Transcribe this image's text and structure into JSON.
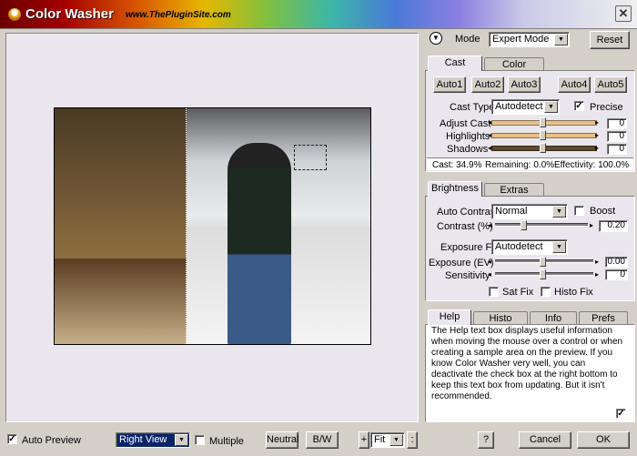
{
  "app": {
    "title": "Color Washer",
    "url": "www.ThePluginSite.com",
    "close_glyph": "✕"
  },
  "mode": {
    "label": "Mode",
    "value": "Expert Mode",
    "reset_label": "Reset"
  },
  "cast_panel": {
    "tabs": [
      {
        "label": "Cast"
      },
      {
        "label": "Color"
      }
    ],
    "auto_buttons": [
      {
        "label": "Auto1"
      },
      {
        "label": "Auto2"
      },
      {
        "label": "Auto3"
      },
      {
        "label": "Auto4"
      },
      {
        "label": "Auto5"
      }
    ],
    "cast_type_label": "Cast Type",
    "cast_type_value": "Autodetect",
    "precise_label": "Precise",
    "precise_checked": true,
    "sliders": [
      {
        "label": "Adjust Cast",
        "value": "0",
        "color": "#e6c28e"
      },
      {
        "label": "Highlights",
        "value": "0",
        "color": "#e8c080"
      },
      {
        "label": "Shadows",
        "value": "0",
        "color": "#5e4a2c"
      }
    ],
    "status": {
      "cast": "Cast: 34.9%",
      "remaining": "Remaining: 0.0%",
      "effectivity": "Effectivity: 100.0%"
    }
  },
  "brightness_panel": {
    "tabs": [
      {
        "label": "Brightness"
      },
      {
        "label": "Extras"
      }
    ],
    "auto_contrast_label": "Auto Contrast",
    "auto_contrast_value": "Normal",
    "boost_label": "Boost",
    "contrast_label": "Contrast (%)",
    "contrast_value": "0.20",
    "exposure_fix_label": "Exposure Fix",
    "exposure_fix_value": "Autodetect",
    "exposure_label": "Exposure (EV)",
    "exposure_value": "0.00",
    "sensitivity_label": "Sensitivity",
    "sensitivity_value": "0",
    "sat_fix_label": "Sat Fix",
    "histo_fix_label": "Histo Fix"
  },
  "help_panel": {
    "tabs": [
      {
        "label": "Help"
      },
      {
        "label": "Histo"
      },
      {
        "label": "Info"
      },
      {
        "label": "Prefs"
      }
    ],
    "text": "The Help text box displays useful information when moving the mouse over a control or when creating a sample area on the preview. If you know Color Washer very well, you can deactivate the check box at the right bottom to keep this text box from updating. But it isn't recommended."
  },
  "bottom_bar": {
    "auto_preview_label": "Auto Preview",
    "view_value": "Right View",
    "multiple_label": "Multiple",
    "neutral_label": "Neutral",
    "bw_label": "B/W",
    "zoom_plus": "+",
    "zoom_value": "Fit",
    "zoom_minus": ":",
    "help_label": "?",
    "cancel_label": "Cancel",
    "ok_label": "OK"
  }
}
